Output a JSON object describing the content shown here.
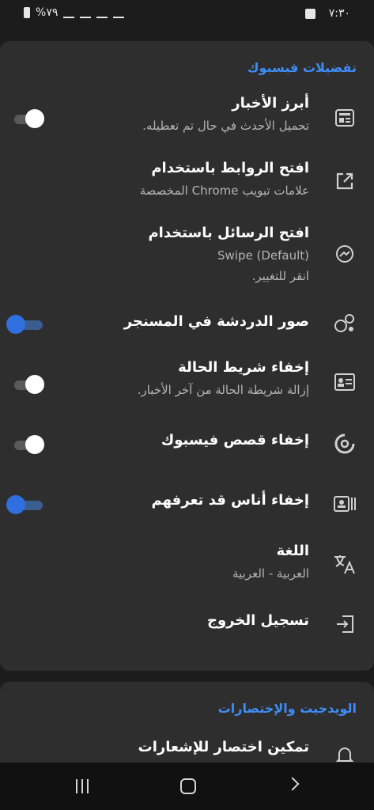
{
  "status_bar": {
    "time": "٧:٣٠",
    "battery": "%٧٩"
  },
  "section1": {
    "title": "تفضيلات فيسبوك",
    "rows": [
      {
        "title": "أبرز الأخبار",
        "subtitle": "تحميل الأحدث في حال تم تعطيله.",
        "icon": "news-feed-icon",
        "toggle": "off"
      },
      {
        "title": "افتح الروابط باستخدام",
        "subtitle": "علامات تبويب Chrome المخصصة",
        "icon": "open-external-icon"
      },
      {
        "title": "افتح الرسائل باستخدام",
        "subtitle": "Swipe (Default)",
        "subtitle2": "انقر للتغيير.",
        "icon": "messenger-icon"
      },
      {
        "title": "صور الدردشة في المسنجر",
        "icon": "chat-heads-icon",
        "toggle": "on"
      },
      {
        "title": "إخفاء شريط الحالة",
        "subtitle": "إزالة شريطة الحالة من آخر الأخبار.",
        "icon": "status-card-icon",
        "toggle": "off"
      },
      {
        "title": "إخفاء قصص فيسبوك",
        "icon": "stories-icon",
        "toggle": "off"
      },
      {
        "title": "إخفاء أناس قد تعرفهم",
        "icon": "people-card-icon",
        "toggle": "on"
      },
      {
        "title": "اللغة",
        "subtitle": "العربية - العربية",
        "icon": "translate-icon"
      },
      {
        "title": "تسجيل الخروج",
        "icon": "logout-icon"
      }
    ]
  },
  "section2": {
    "title": "الويدجيت والإختصارات",
    "rows": [
      {
        "title": "تمكين اختصار للإشعارات",
        "icon": "notification-bell-icon"
      }
    ]
  },
  "colors": {
    "accent": "#3f8cf5",
    "card": "#2e2e2e",
    "background": "#1c1c1c"
  }
}
